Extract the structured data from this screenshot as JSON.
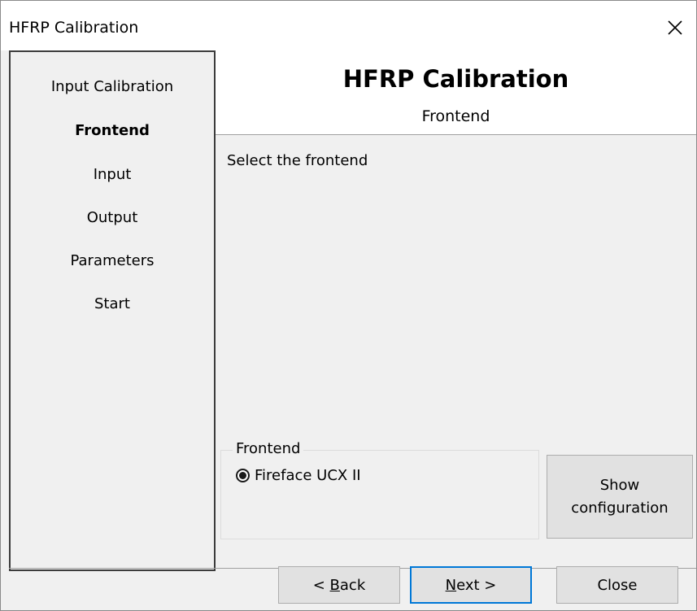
{
  "window": {
    "title": "HFRP Calibration",
    "close_glyph": "✕"
  },
  "sidebar": {
    "items": [
      {
        "label": "Input Calibration",
        "active": false
      },
      {
        "label": "Frontend",
        "active": true
      },
      {
        "label": "Input",
        "active": false
      },
      {
        "label": "Output",
        "active": false
      },
      {
        "label": "Parameters",
        "active": false
      },
      {
        "label": "Start",
        "active": false
      }
    ]
  },
  "header": {
    "title": "HFRP Calibration",
    "subtitle": "Frontend"
  },
  "main": {
    "instruction": "Select the frontend",
    "group": {
      "legend": "Frontend",
      "options": [
        {
          "label": "Fireface UCX II",
          "selected": true
        }
      ]
    },
    "show_config_button": {
      "line1": "Show",
      "line2": "configuration"
    }
  },
  "footer": {
    "back_prefix": "< ",
    "back_mnemonic": "B",
    "back_rest": "ack",
    "next_mnemonic": "N",
    "next_rest": "ext >",
    "close_label": "Close"
  },
  "colors": {
    "accent": "#0078d7",
    "window_bg": "#f0f0f0",
    "header_bg": "#ffffff"
  }
}
